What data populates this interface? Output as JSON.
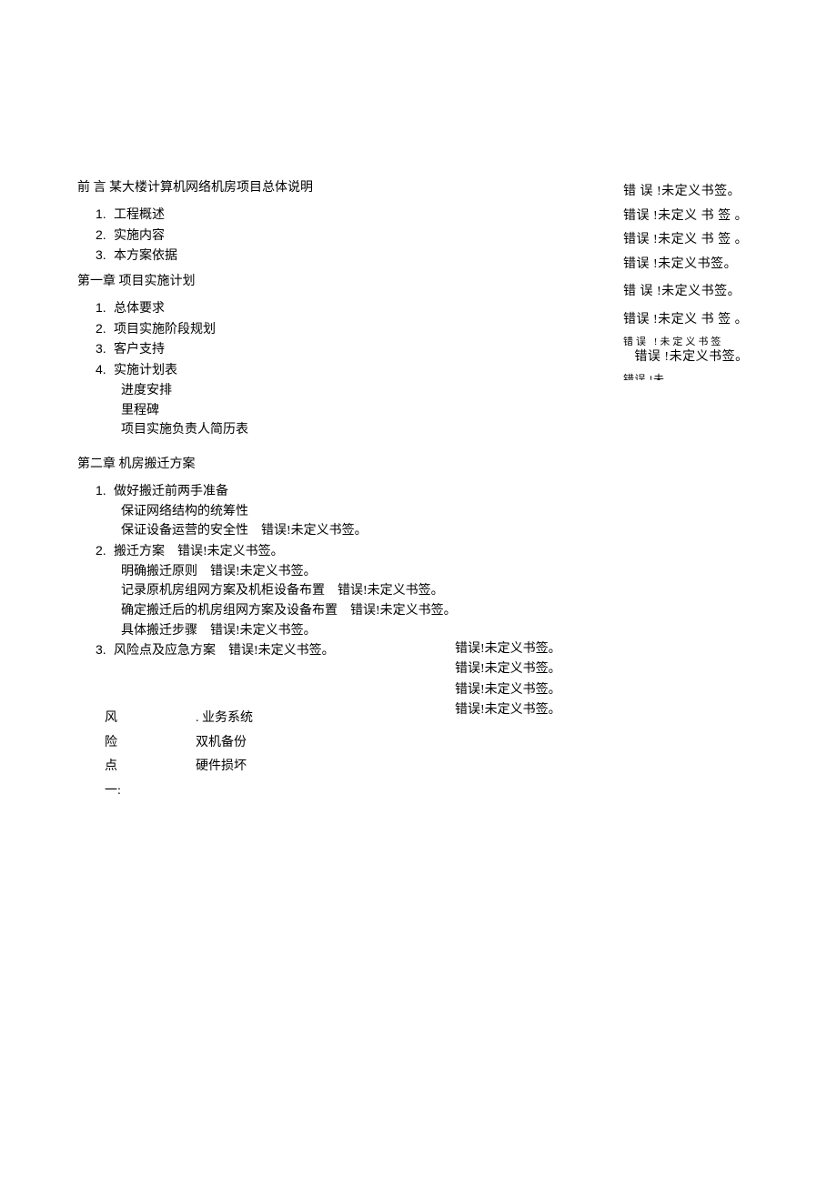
{
  "toc": {
    "preface": "前 言 某大楼计算机网络机房项目总体说明",
    "items_a": [
      {
        "num": "1.",
        "label": "工程概述"
      },
      {
        "num": "2.",
        "label": "实施内容"
      },
      {
        "num": "3.",
        "label": "本方案依据"
      }
    ],
    "chapter1": "第一章 项目实施计划",
    "items_b": [
      {
        "num": "1.",
        "label": "总体要求"
      },
      {
        "num": "2.",
        "label": "项目实施阶段规划"
      },
      {
        "num": "3.",
        "label": "客户支持"
      },
      {
        "num": "4.",
        "label": "实施计划表"
      }
    ],
    "sub_b": [
      "进度安排",
      "里程碑",
      "项目实施负责人简历表"
    ],
    "chapter2": "第二章 机房搬迁方案",
    "items_c1": {
      "num": "1.",
      "label": "做好搬迁前两手准备"
    },
    "sub_c1a": "保证网络结构的统筹性",
    "sub_c1b": "保证设备运营的安全性",
    "items_c2": {
      "num": "2.",
      "label": "搬迁方案"
    },
    "sub_c2": [
      "明确搬迁原则",
      "记录原机房组网方案及机柜设备布置",
      "确定搬迁后的机房组网方案及设备布置",
      "具体搬迁步骤"
    ],
    "items_c3": {
      "num": "3.",
      "label": "风险点及应急方案"
    },
    "err": "错误!未定义书签。"
  },
  "right": {
    "r1": "错 误 !未定义书签。",
    "r2": "错误 !未定义 书 签 。",
    "r3": "错误 !未定义 书 签 。",
    "r4": "错误 !未定义书签。",
    "r5": "错 误 !未定义书签。",
    "r6": "错误 !未定义 书 签 。",
    "r7": "错误 !未定义书签",
    "r8": "错误 !未定义书签。",
    "r9": "错误 !未"
  },
  "mid_errors": [
    "错误!未定义书签。",
    "错误!未定义书签。",
    "错误!未定义书签。",
    "错误!未定义书签。"
  ],
  "risk": {
    "col_a": [
      "风",
      "险",
      "点",
      "一:"
    ],
    "col_b_dot": ".",
    "col_b": [
      "业务系统",
      "双机备份",
      "硬件损坏"
    ]
  }
}
